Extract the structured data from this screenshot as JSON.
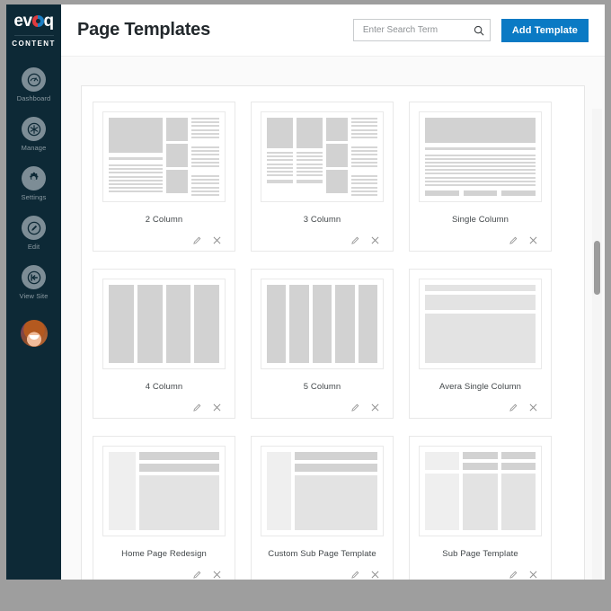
{
  "sidebar": {
    "logo": {
      "brand": "evoq",
      "brand_pre": "ev",
      "brand_post": "q",
      "sub": "CONTENT"
    },
    "items": [
      {
        "label": "Dashboard",
        "icon": "gauge-icon"
      },
      {
        "label": "Manage",
        "icon": "asterisk-icon"
      },
      {
        "label": "Settings",
        "icon": "gear-icon"
      },
      {
        "label": "Edit",
        "icon": "pencil-icon"
      },
      {
        "label": "View Site",
        "icon": "exit-arrow-icon"
      }
    ],
    "avatar_alt": "User avatar"
  },
  "header": {
    "title": "Page Templates",
    "search": {
      "placeholder": "Enter Search Term",
      "value": ""
    },
    "add_button": "Add Template"
  },
  "colors": {
    "sidebar_bg": "#0d2936",
    "accent": "#0a7ac4",
    "page_bg": "#fafafa",
    "frame": "#9e9e9e"
  },
  "actions": {
    "edit_title": "Edit",
    "delete_title": "Delete"
  },
  "templates": [
    {
      "label": "2 Column",
      "layout": "two-column"
    },
    {
      "label": "3 Column",
      "layout": "three-column"
    },
    {
      "label": "Single Column",
      "layout": "single-column"
    },
    {
      "label": "4 Column",
      "layout": "four-column"
    },
    {
      "label": "5 Column",
      "layout": "five-column"
    },
    {
      "label": "Avera Single Column",
      "layout": "avera-single-column"
    },
    {
      "label": "Home Page Redesign",
      "layout": "home-page-redesign"
    },
    {
      "label": "Custom Sub Page Template",
      "layout": "custom-sub-page"
    },
    {
      "label": "Sub Page Template",
      "layout": "sub-page"
    }
  ],
  "scrollbar": {
    "position_pct": 30
  }
}
